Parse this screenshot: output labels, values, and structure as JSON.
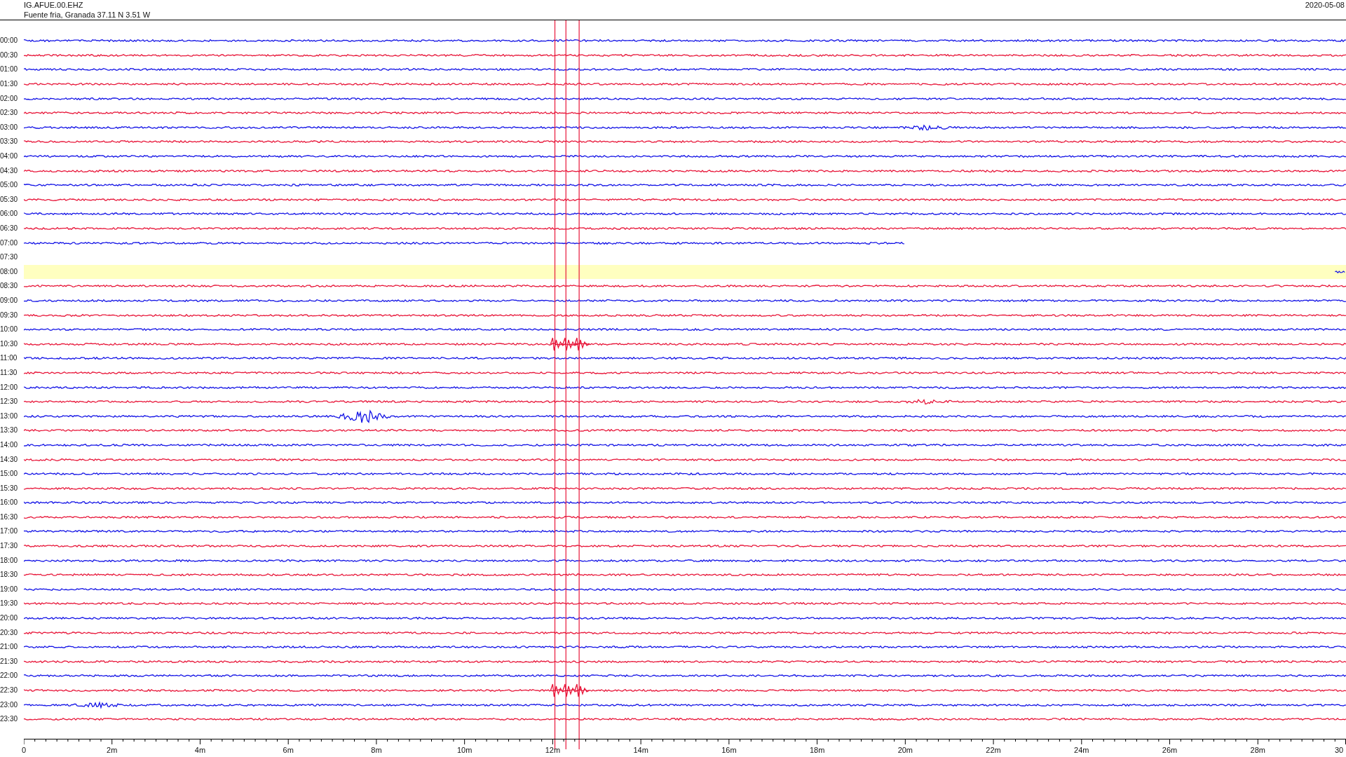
{
  "header": {
    "station": "IG.AFUE.00.EHZ",
    "location": "Fuente fria, Granada  37.11 N 3.51 W",
    "date": "2020-05-08"
  },
  "rows": [
    {
      "label": "00:00",
      "color": "#1414e6",
      "kind": "full"
    },
    {
      "label": "00:30",
      "color": "#e8173a",
      "kind": "full"
    },
    {
      "label": "01:00",
      "color": "#1414e6",
      "kind": "full"
    },
    {
      "label": "01:30",
      "color": "#e8173a",
      "kind": "full"
    },
    {
      "label": "02:00",
      "color": "#1414e6",
      "kind": "full"
    },
    {
      "label": "02:30",
      "color": "#e8173a",
      "kind": "full"
    },
    {
      "label": "03:00",
      "color": "#1414e6",
      "kind": "full"
    },
    {
      "label": "03:30",
      "color": "#e8173a",
      "kind": "full"
    },
    {
      "label": "04:00",
      "color": "#1414e6",
      "kind": "full"
    },
    {
      "label": "04:30",
      "color": "#e8173a",
      "kind": "full"
    },
    {
      "label": "05:00",
      "color": "#1414e6",
      "kind": "full"
    },
    {
      "label": "05:30",
      "color": "#e8173a",
      "kind": "full"
    },
    {
      "label": "06:00",
      "color": "#1414e6",
      "kind": "full"
    },
    {
      "label": "06:30",
      "color": "#e8173a",
      "kind": "full"
    },
    {
      "label": "07:00",
      "color": "#1414e6",
      "kind": "partial"
    },
    {
      "label": "07:30",
      "kind": "empty"
    },
    {
      "label": "08:00",
      "color": "#1414e6",
      "kind": "current"
    },
    {
      "label": "08:30",
      "color": "#e8173a",
      "kind": "full"
    },
    {
      "label": "09:00",
      "color": "#1414e6",
      "kind": "full"
    },
    {
      "label": "09:30",
      "color": "#e8173a",
      "kind": "full"
    },
    {
      "label": "10:00",
      "color": "#1414e6",
      "kind": "full"
    },
    {
      "label": "10:30",
      "color": "#e8173a",
      "kind": "event"
    },
    {
      "label": "11:00",
      "color": "#1414e6",
      "kind": "full"
    },
    {
      "label": "11:30",
      "color": "#e8173a",
      "kind": "full"
    },
    {
      "label": "12:00",
      "color": "#1414e6",
      "kind": "full"
    },
    {
      "label": "12:30",
      "color": "#e8173a",
      "kind": "full"
    },
    {
      "label": "13:00",
      "color": "#1414e6",
      "kind": "full"
    },
    {
      "label": "13:30",
      "color": "#e8173a",
      "kind": "full"
    },
    {
      "label": "14:00",
      "color": "#1414e6",
      "kind": "full"
    },
    {
      "label": "14:30",
      "color": "#e8173a",
      "kind": "full"
    },
    {
      "label": "15:00",
      "color": "#1414e6",
      "kind": "full"
    },
    {
      "label": "15:30",
      "color": "#e8173a",
      "kind": "full"
    },
    {
      "label": "16:00",
      "color": "#1414e6",
      "kind": "full"
    },
    {
      "label": "16:30",
      "color": "#e8173a",
      "kind": "full"
    },
    {
      "label": "17:00",
      "color": "#1414e6",
      "kind": "full"
    },
    {
      "label": "17:30",
      "color": "#e8173a",
      "kind": "full"
    },
    {
      "label": "18:00",
      "color": "#1414e6",
      "kind": "full"
    },
    {
      "label": "18:30",
      "color": "#e8173a",
      "kind": "full"
    },
    {
      "label": "19:00",
      "color": "#1414e6",
      "kind": "full"
    },
    {
      "label": "19:30",
      "color": "#e8173a",
      "kind": "full"
    },
    {
      "label": "20:00",
      "color": "#1414e6",
      "kind": "full"
    },
    {
      "label": "20:30",
      "color": "#e8173a",
      "kind": "full"
    },
    {
      "label": "21:00",
      "color": "#1414e6",
      "kind": "full"
    },
    {
      "label": "21:30",
      "color": "#e8173a",
      "kind": "full"
    },
    {
      "label": "22:00",
      "color": "#1414e6",
      "kind": "full"
    },
    {
      "label": "22:30",
      "color": "#e8173a",
      "kind": "event"
    },
    {
      "label": "23:00",
      "color": "#1414e6",
      "kind": "full"
    },
    {
      "label": "23:30",
      "color": "#e8173a",
      "kind": "full"
    }
  ],
  "axis": {
    "ticks": [
      "0",
      "2m",
      "4m",
      "6m",
      "8m",
      "10m",
      "12m",
      "14m",
      "16m",
      "18m",
      "20m",
      "22m",
      "24m",
      "26m",
      "28m",
      "30"
    ]
  }
}
